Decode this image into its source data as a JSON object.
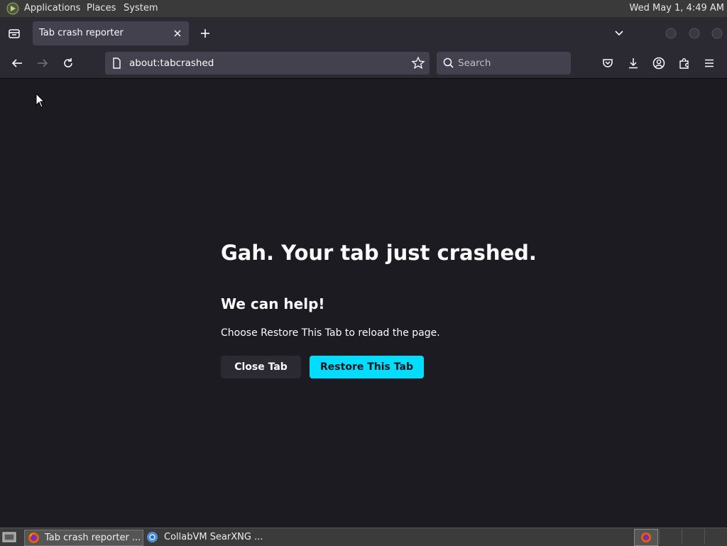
{
  "desktop": {
    "menus": [
      "Applications",
      "Places",
      "System"
    ],
    "clock": "Wed May 1,  4:49 AM"
  },
  "browser": {
    "tab_title": "Tab crash reporter",
    "url": "about:tabcrashed",
    "search_placeholder": "Search"
  },
  "page": {
    "title": "Gah. Your tab just crashed.",
    "subtitle": "We can help!",
    "description": "Choose Restore This Tab to reload the page.",
    "close_button": "Close Tab",
    "restore_button": "Restore This Tab",
    "accent_color": "#00ddff"
  },
  "taskbar": {
    "items": [
      "Tab crash reporter ...",
      "CollabVM SearXNG ..."
    ]
  },
  "icons": [
    "gnome-foot-icon",
    "tab-manager-icon",
    "close-icon",
    "new-tab-icon",
    "chevron-down-icon",
    "back-icon",
    "forward-icon",
    "reload-icon",
    "page-icon",
    "bookmark-star-icon",
    "search-icon",
    "pocket-icon",
    "download-icon",
    "account-icon",
    "extensions-icon",
    "menu-icon",
    "firefox-icon",
    "chromium-icon",
    "show-desktop-icon"
  ]
}
